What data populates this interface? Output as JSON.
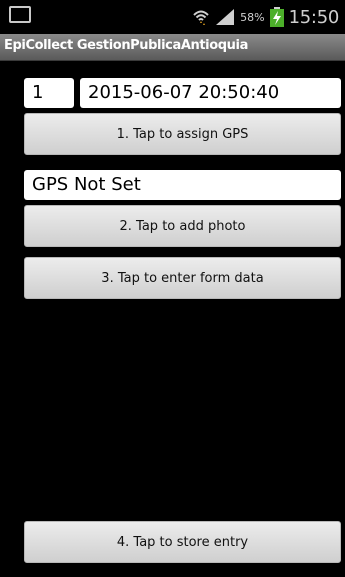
{
  "status_bar": {
    "battery_percent": "58%",
    "time": "15:50",
    "icons": [
      "gallery-icon",
      "wifi-icon",
      "signal-icon",
      "battery-charging-icon"
    ]
  },
  "app": {
    "title": "EpiCollect GestionPublicaAntioquia"
  },
  "form": {
    "entry_number": "1",
    "timestamp": "2015-06-07 20:50:40",
    "gps_status": "GPS Not Set",
    "buttons": {
      "assign_gps": "1. Tap to assign GPS",
      "add_photo": "2. Tap to add photo",
      "enter_form": "3. Tap to enter form data",
      "store_entry": "4. Tap to store entry"
    }
  },
  "colors": {
    "background": "#000000",
    "button_top": "#ececec",
    "button_bottom": "#cfcfcf",
    "field": "#ffffff",
    "battery_green": "#4caf2a"
  }
}
